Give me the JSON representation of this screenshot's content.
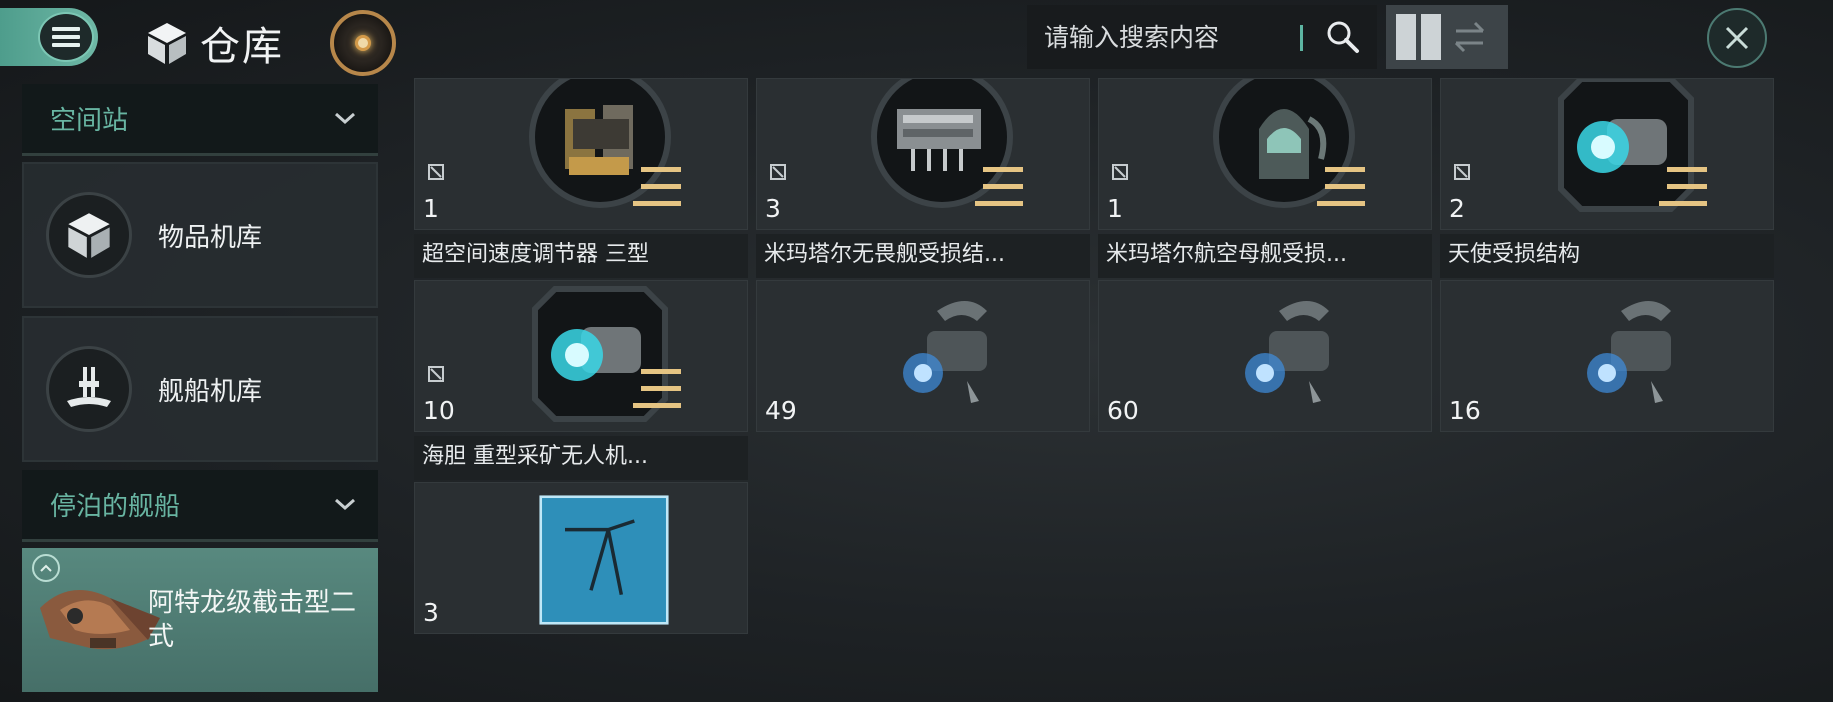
{
  "header": {
    "title": "仓库",
    "search_placeholder": "请输入搜索内容"
  },
  "sidebar": {
    "station_header": "空间站",
    "items": [
      {
        "label": "物品机库"
      },
      {
        "label": "舰船机库"
      }
    ],
    "docked_header": "停泊的舰船",
    "docked_ship": {
      "label": "阿特龙级截击型二式"
    }
  },
  "items": [
    {
      "name": "超空间速度调节器 三型",
      "count": "1",
      "icon": "hyperspace-regulator-icon"
    },
    {
      "name": "米玛塔尔无畏舰受损结...",
      "count": "3",
      "icon": "dreadnought-structure-icon"
    },
    {
      "name": "米玛塔尔航空母舰受损...",
      "count": "1",
      "icon": "carrier-structure-icon"
    },
    {
      "name": "天使受损结构",
      "count": "2",
      "icon": "angel-structure-icon"
    },
    {
      "name": "海胆 重型采矿无人机...",
      "count": "10",
      "icon": "heavy-mining-drone-icon"
    },
    {
      "name": "",
      "count": "49",
      "icon": "blueprint-component-icon"
    },
    {
      "name": "",
      "count": "60",
      "icon": "blueprint-component-icon"
    },
    {
      "name": "",
      "count": "16",
      "icon": "blueprint-component-icon"
    },
    {
      "name": "",
      "count": "3",
      "icon": "drone-blueprint-icon"
    }
  ],
  "colors": {
    "accent": "#5db5a2",
    "grade": "#e5c483",
    "panel": "#2a2f32"
  }
}
